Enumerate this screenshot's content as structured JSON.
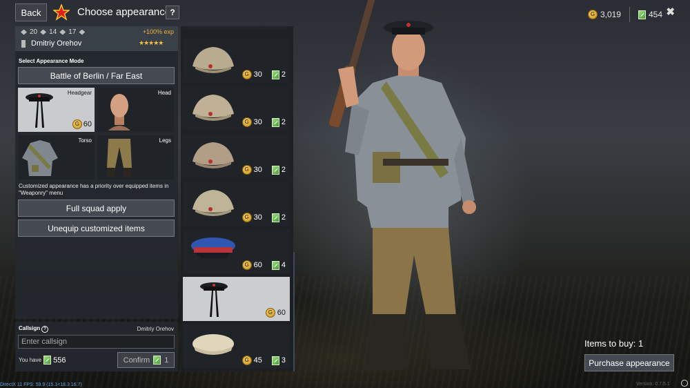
{
  "header": {
    "back_label": "Back",
    "title": "Choose appearance",
    "help_label": "?",
    "gold_amount": "3,019",
    "tickets_amount": "454",
    "close_label": "✖",
    "icons": {
      "star": "star-icon",
      "gold": "gold-coin-icon",
      "ticket": "ticket-icon",
      "close": "close-icon"
    }
  },
  "soldier": {
    "stats": [
      "20",
      "14",
      "17"
    ],
    "exp_bonus": "+100% exp",
    "name": "Dmitriy Orehov",
    "rating": "★★★★★"
  },
  "appearance": {
    "mode_label": "Select Appearance Mode",
    "mode_value": "Battle of Berlin / Far East",
    "slots": [
      {
        "label": "Headgear",
        "price": "60",
        "selected": true
      },
      {
        "label": "Head"
      },
      {
        "label": "Torso"
      },
      {
        "label": "Legs"
      }
    ],
    "note": "Customized appearance has a priority over equipped items in \"Weaponry\" menu",
    "full_squad_label": "Full squad apply",
    "unequip_label": "Unequip customized items"
  },
  "callsign": {
    "label": "Callsign",
    "current_name": "Dmitriy Orehov",
    "placeholder": "Enter callsign",
    "you_have_label": "You have",
    "you_have_amount": "556",
    "confirm_label": "Confirm",
    "confirm_cost": "1"
  },
  "items": [
    {
      "type": "cap-star",
      "gold": "30",
      "tickets": "2"
    },
    {
      "type": "cap-star",
      "gold": "30",
      "tickets": "2"
    },
    {
      "type": "cap-star",
      "gold": "30",
      "tickets": "2"
    },
    {
      "type": "cap-star",
      "gold": "30",
      "tickets": "2"
    },
    {
      "type": "nkvd-cap",
      "gold": "60",
      "tickets": "4"
    },
    {
      "type": "naval-cap",
      "gold": "60",
      "selected": true
    },
    {
      "type": "light-cap",
      "gold": "45",
      "tickets": "3"
    }
  ],
  "purchase": {
    "items_to_buy_label": "Items to buy: 1",
    "purchase_label": "Purchase appearance"
  },
  "footer": {
    "fps_text": "DirectX 11 FPS: 59.9 (15.1<18.3 16.7)",
    "version_text": "Version: 0.7.5.1"
  }
}
